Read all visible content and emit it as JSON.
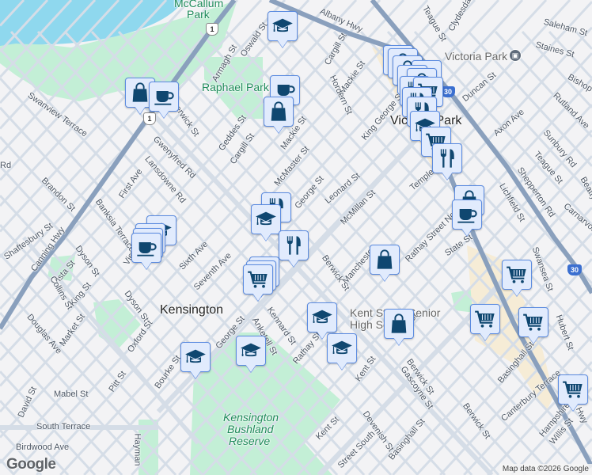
{
  "map": {
    "colors": {
      "water": "#8fd8ee",
      "park": "#bff0d4",
      "road": "#d5dde7",
      "highway": "#8aa0bd",
      "marker_bg": "#e1ebfd",
      "marker_icon": "#0f4770",
      "marker_border": "#5b8be0",
      "commercial": "#f6ecd6"
    },
    "route_shields": [
      "1",
      "1",
      "30",
      "30"
    ],
    "places": {
      "kensington": "Kensington",
      "victoria_park": "Victoria Park",
      "mccallum_park_1": "McCallum",
      "mccallum_park_2": "Park",
      "raphael_park": "Raphael Park",
      "bushland_1": "Kensington",
      "bushland_2": "Bushland",
      "bushland_3": "Reserve",
      "school_1": "Kent Street Senior",
      "school_2": "High School",
      "station": "Victoria Park",
      "station_icon": "train-icon"
    },
    "streets": [
      "Albany Hwy",
      "Oswald St",
      "Armagh St",
      "Geddes St",
      "Cargill St",
      "Mackie St",
      "McMaster St",
      "Cargill St",
      "Mackie St",
      "Hordern St",
      "King George St",
      "Teague St",
      "Clydesdale",
      "Saleham St",
      "Staines St",
      "Bishop",
      "Rutland Ave",
      "Duncan St",
      "Axon Ave",
      "Sunbury Rd",
      "Teague St",
      "Beatty",
      "Carnarvon St",
      "Shepperton Rd",
      "Lichfield St",
      "Temple St",
      "Leonard St",
      "McMillan St",
      "George St",
      "State St",
      "Rathay Street North",
      "Manchester",
      "Berwick St",
      "Berwick St",
      "Swanview Terrace",
      "Gwenyfred Rd",
      "Lansdowne Rd",
      "First Ave",
      "Brandon St",
      "Banksia Terrace",
      "Dyson St",
      "View St",
      "Sixth Ave",
      "Seventh Ave",
      "Canning Hwy",
      "Shaftesbury St",
      "Vista St",
      "Collins St",
      "King St",
      "Douglas Ave",
      "Market St",
      "Dyson St",
      "Oxford St",
      "Kennard St",
      "Anketell St",
      "George St",
      "Bourke St",
      "Pitt St",
      "Rathay St",
      "Mabel St",
      "David St",
      "South Terrace",
      "Birdwood Ave",
      "Hayman",
      "Kent St",
      "Kent St",
      "Kent St",
      "Berwick St",
      "Berwick St",
      "Gascoyne St",
      "Devenish St",
      "Basinghall St",
      "Basinghall St",
      "Canterbury Terrace",
      "Hampshire St",
      "Willis St",
      "Hubert St",
      "Albany Hwy",
      "Swansea St",
      "Street South",
      "Rd"
    ],
    "markers": [
      {
        "type": "school"
      },
      {
        "type": "bag"
      },
      {
        "type": "coffee"
      },
      {
        "type": "coffee"
      },
      {
        "type": "bag"
      },
      {
        "type": "bag"
      },
      {
        "type": "bag"
      },
      {
        "type": "bag"
      },
      {
        "type": "cart"
      },
      {
        "type": "bag"
      },
      {
        "type": "bag"
      },
      {
        "type": "fork-knife"
      },
      {
        "type": "cart"
      },
      {
        "type": "fork-knife"
      },
      {
        "type": "fork-knife"
      },
      {
        "type": "school"
      },
      {
        "type": "cart"
      },
      {
        "type": "fork-knife"
      },
      {
        "type": "bag"
      },
      {
        "type": "coffee"
      },
      {
        "type": "fork-knife"
      },
      {
        "type": "school"
      },
      {
        "type": "fork-knife"
      },
      {
        "type": "school"
      },
      {
        "type": "coffee"
      },
      {
        "type": "coffee"
      },
      {
        "type": "coffee"
      },
      {
        "type": "cart"
      },
      {
        "type": "cart"
      },
      {
        "type": "cart"
      },
      {
        "type": "bag"
      },
      {
        "type": "school"
      },
      {
        "type": "bag"
      },
      {
        "type": "school"
      },
      {
        "type": "cart"
      },
      {
        "type": "cart"
      },
      {
        "type": "cart"
      },
      {
        "type": "cart"
      },
      {
        "type": "school"
      },
      {
        "type": "school"
      }
    ],
    "logo": "Google",
    "attribution": "Map data ©2026 Google"
  }
}
